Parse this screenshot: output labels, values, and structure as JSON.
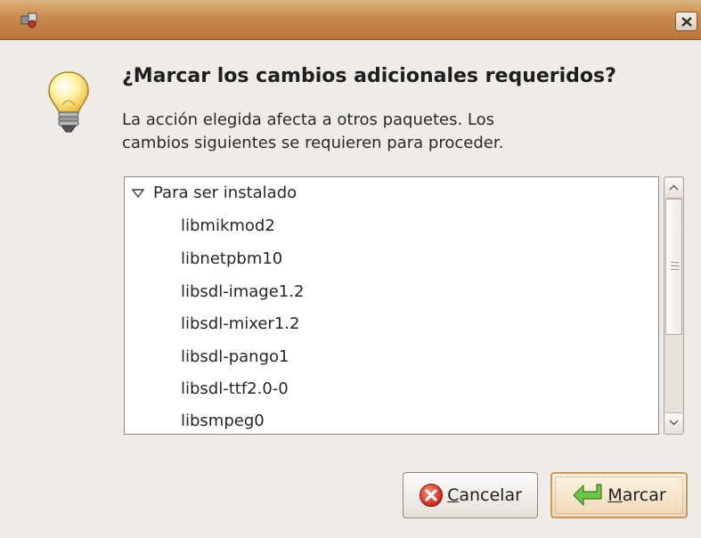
{
  "window": {
    "app_icon": "package-manager-icon",
    "close_icon": "close-icon"
  },
  "dialog": {
    "icon": "lightbulb-icon",
    "heading": "¿Marcar los cambios adicionales requeridos?",
    "description_line1": "La acción elegida afecta a otros paquetes. Los",
    "description_line2": "cambios siguientes se requieren para proceder."
  },
  "changes": {
    "group_label": "Para ser instalado",
    "packages": [
      "libmikmod2",
      "libnetpbm10",
      "libsdl-image1.2",
      "libsdl-mixer1.2",
      "libsdl-pango1",
      "libsdl-ttf2.0-0",
      "libsmpeg0"
    ]
  },
  "buttons": {
    "cancel": {
      "mnemonic": "C",
      "rest": "ancelar",
      "icon": "cancel-icon"
    },
    "mark": {
      "mnemonic": "M",
      "rest": "arcar",
      "icon": "apply-arrow-icon"
    }
  },
  "colors": {
    "titlebar": "#c98a4c",
    "window_bg": "#efebe7",
    "default_button": "#efd9b7"
  }
}
